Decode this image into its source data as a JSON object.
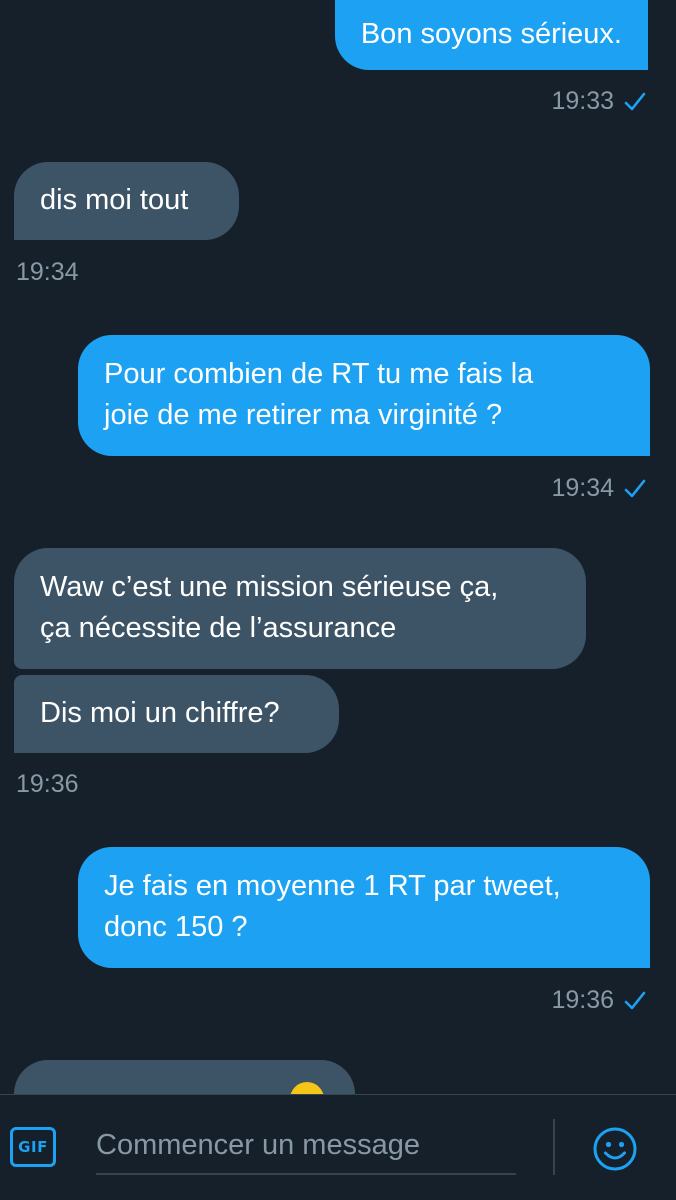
{
  "messages": [
    {
      "direction": "out",
      "lines": [
        "Bon soyons sérieux."
      ],
      "time": "19:33"
    },
    {
      "direction": "in",
      "lines": [
        "dis moi tout"
      ],
      "time": "19:34"
    },
    {
      "direction": "out",
      "lines": [
        "Pour combien de RT tu me fais la",
        "joie de me retirer ma virginité ?"
      ],
      "time": "19:34"
    },
    {
      "direction": "in",
      "lines": [
        "Waw c’est une mission sérieuse ça,",
        "ça nécessite de l’assurance"
      ]
    },
    {
      "direction": "in",
      "lines": [
        "Dis moi un chiffre?"
      ],
      "time": "19:36"
    },
    {
      "direction": "out",
      "lines": [
        "Je fais en moyenne 1 RT par tweet,",
        "donc 150 ?"
      ],
      "time": "19:36"
    }
  ],
  "composer": {
    "gif_label": "GIF",
    "placeholder": "Commencer un message",
    "emoji_icon": "smiley-icon"
  },
  "colors": {
    "background": "#15202b",
    "outgoing_bubble": "#1da1f2",
    "incoming_bubble": "#3d5466",
    "timestamp": "#8899a6",
    "accent": "#1da1f2"
  }
}
